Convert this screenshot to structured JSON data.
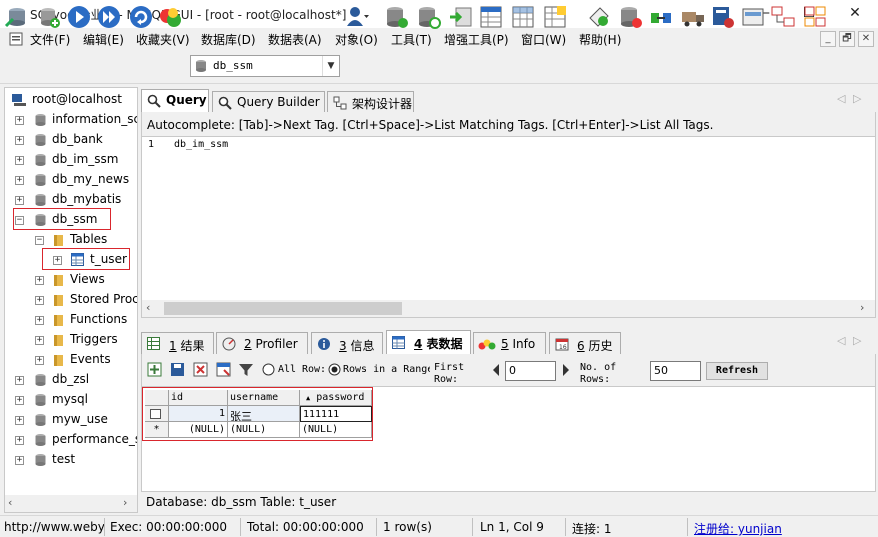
{
  "window": {
    "title": "SQLyog 企业版 - MySQL GUI - [root - root@localhost*]",
    "minimize": "—",
    "maximize": "☐",
    "close": "✕"
  },
  "menu": {
    "items": [
      "文件(F)",
      "编辑(E)",
      "收藏夹(V)",
      "数据库(D)",
      "数据表(A)",
      "对象(O)",
      "工具(T)",
      "增强工具(P)",
      "窗口(W)",
      "帮助(H)"
    ],
    "mdi_min": "_",
    "mdi_restore": "🗗",
    "mdi_close": "✕"
  },
  "toolbar": {
    "database_selected": "db_ssm"
  },
  "tree": {
    "root": "root@localhost",
    "databases": [
      "information_schema",
      "db_bank",
      "db_im_ssm",
      "db_my_news",
      "db_mybatis",
      "db_ssm",
      "db_zsl",
      "mysql",
      "myw_use",
      "performance_schema",
      "test"
    ],
    "expanded_db": "db_ssm",
    "folders": [
      "Tables",
      "Views",
      "Stored Procs",
      "Functions",
      "Triggers",
      "Events"
    ],
    "table": "t_user"
  },
  "query_tabs": [
    "Query",
    "Query Builder",
    "架构设计器"
  ],
  "autocomplete": "Autocomplete: [Tab]->Next Tag. [Ctrl+Space]->List Matching Tags. [Ctrl+Enter]->List All Tags.",
  "editor": {
    "line_number": "1",
    "text": "db_im_ssm"
  },
  "result_tabs": [
    {
      "num": "1",
      "label": "结果"
    },
    {
      "num": "2",
      "label": "Profiler"
    },
    {
      "num": "3",
      "label": "信息"
    },
    {
      "num": "4",
      "label": "表数据"
    },
    {
      "num": "5",
      "label": "Info"
    },
    {
      "num": "6",
      "label": "历史"
    }
  ],
  "result_toolbar": {
    "all_label": "All",
    "row_label": "Row:",
    "rows_in_range": "Rows in a Range",
    "first_row_label": "First Row:",
    "first_row_value": "0",
    "no_rows_label": "No. of Rows:",
    "no_rows_value": "50",
    "refresh": "Refresh"
  },
  "grid": {
    "columns": [
      "id",
      "username",
      "password"
    ],
    "rows": [
      [
        "1",
        "张三",
        "111111"
      ],
      [
        "(NULL)",
        "(NULL)",
        "(NULL)"
      ]
    ],
    "row_markers": [
      "☐",
      "*"
    ]
  },
  "info_line": "Database: db_ssm  Table: t_user",
  "statusbar": {
    "url": "http://www.webyog.com",
    "exec": "Exec: 00:00:00:000",
    "total": "Total: 00:00:00:000",
    "rows": "1 row(s)",
    "position": "Ln 1, Col 9",
    "connections": "连接: 1",
    "registered": "注册给: yunjian"
  },
  "colors": {
    "highlight": "#d9262d",
    "folder": "#e8b84a",
    "link": "#0000cc"
  }
}
